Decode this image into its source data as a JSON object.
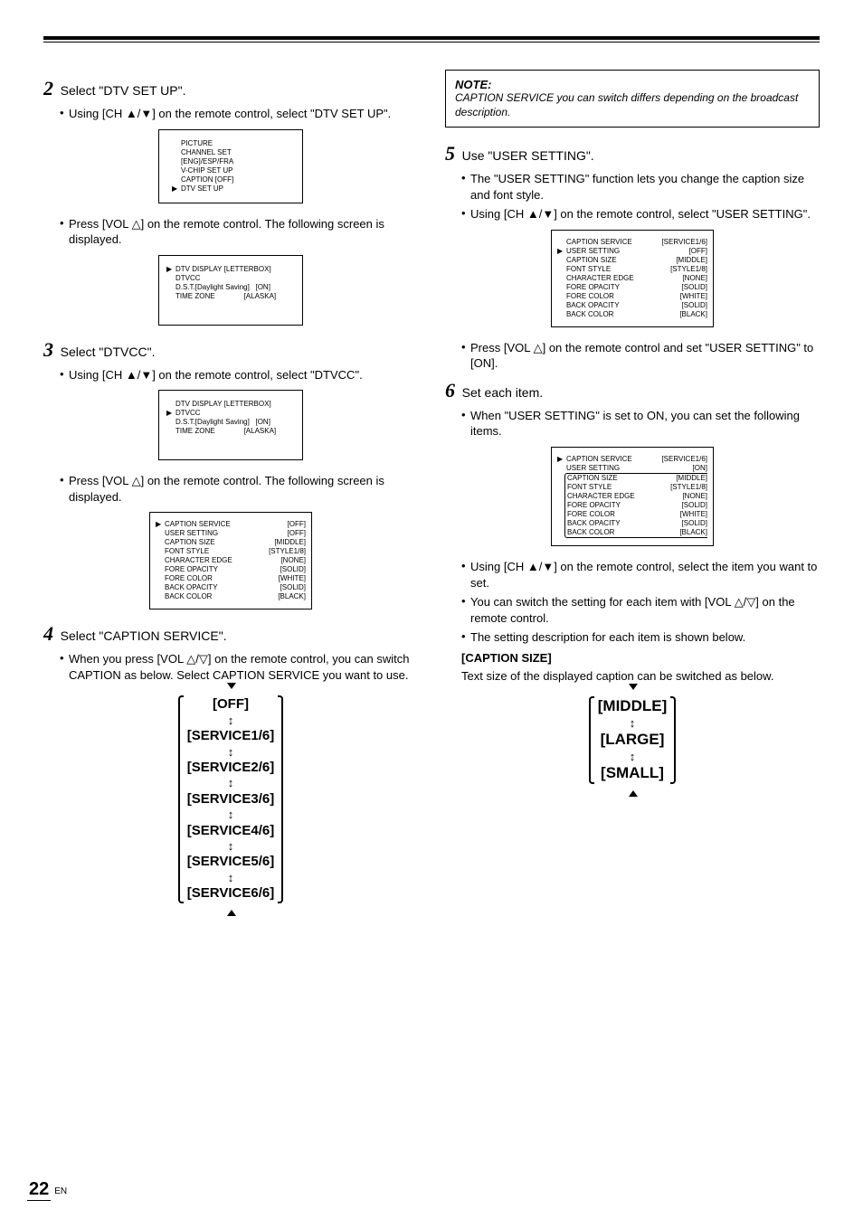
{
  "pageNumber": "22",
  "pageLang": "EN",
  "left": {
    "step2": {
      "num": "2",
      "title": "Select \"DTV SET UP\".",
      "b1": "Using [CH ▲/▼] on the remote control, select \"DTV SET UP\".",
      "menu1": {
        "r1": "PICTURE",
        "r2": "CHANNEL SET",
        "r3": "[ENG]/ESP/FRA",
        "r4": "V-CHIP SET UP",
        "r5": "CAPTION [OFF]",
        "r6": "DTV SET UP"
      },
      "b2": "Press [VOL △] on the remote control. The following screen is displayed.",
      "menu2": {
        "r1l": "DTV DISPLAY",
        "r1v": "[LETTERBOX]",
        "r2l": "DTVCC",
        "r3l": "D.S.T.[Daylight Saving]",
        "r3v": "[ON]",
        "r4l": "TIME ZONE",
        "r4v": "[ALASKA]"
      }
    },
    "step3": {
      "num": "3",
      "title": "Select \"DTVCC\".",
      "b1": "Using [CH ▲/▼] on the remote control, select \"DTVCC\".",
      "menu1": {
        "r1l": "DTV DISPLAY",
        "r1v": "[LETTERBOX]",
        "r2l": "DTVCC",
        "r3l": "D.S.T.[Daylight Saving]",
        "r3v": "[ON]",
        "r4l": "TIME ZONE",
        "r4v": "[ALASKA]"
      },
      "b2": "Press [VOL △] on the remote control. The following screen is displayed.",
      "menu2": {
        "r1l": "CAPTION SERVICE",
        "r1v": "[OFF]",
        "r2l": "USER SETTING",
        "r2v": "[OFF]",
        "r3l": "CAPTION SIZE",
        "r3v": "[MIDDLE]",
        "r4l": "FONT STYLE",
        "r4v": "[STYLE1/8]",
        "r5l": "CHARACTER EDGE",
        "r5v": "[NONE]",
        "r6l": "FORE OPACITY",
        "r6v": "[SOLID]",
        "r7l": "FORE COLOR",
        "r7v": "[WHITE]",
        "r8l": "BACK OPACITY",
        "r8v": "[SOLID]",
        "r9l": "BACK COLOR",
        "r9v": "[BLACK]"
      }
    },
    "step4": {
      "num": "4",
      "title": "Select \"CAPTION SERVICE\".",
      "b1": "When you press [VOL △/▽] on the remote control, you can switch CAPTION as below. Select CAPTION SERVICE you want to use.",
      "cycle": {
        "i1": "[OFF]",
        "i2": "[SERVICE1/6]",
        "i3": "[SERVICE2/6]",
        "i4": "[SERVICE3/6]",
        "i5": "[SERVICE4/6]",
        "i6": "[SERVICE5/6]",
        "i7": "[SERVICE6/6]"
      }
    }
  },
  "right": {
    "note": {
      "title": "NOTE:",
      "text": "CAPTION SERVICE you can switch differs depending on the broadcast description."
    },
    "step5": {
      "num": "5",
      "title": "Use \"USER SETTING\".",
      "b1": "The \"USER SETTING\" function lets you change the caption size and font style.",
      "b2": "Using [CH ▲/▼] on the remote control, select \"USER SETTING\".",
      "menu": {
        "r1l": "CAPTION SERVICE",
        "r1v": "[SERVICE1/6]",
        "r2l": "USER SETTING",
        "r2v": "[OFF]",
        "r3l": "CAPTION SIZE",
        "r3v": "[MIDDLE]",
        "r4l": "FONT STYLE",
        "r4v": "[STYLE1/8]",
        "r5l": "CHARACTER EDGE",
        "r5v": "[NONE]",
        "r6l": "FORE OPACITY",
        "r6v": "[SOLID]",
        "r7l": "FORE COLOR",
        "r7v": "[WHITE]",
        "r8l": "BACK OPACITY",
        "r8v": "[SOLID]",
        "r9l": "BACK COLOR",
        "r9v": "[BLACK]"
      },
      "b3": "Press [VOL △] on the remote control and set \"USER SETTING\" to [ON]."
    },
    "step6": {
      "num": "6",
      "title": "Set each item.",
      "b1": "When \"USER SETTING\" is set to ON, you can set the following items.",
      "menu": {
        "r1l": "CAPTION SERVICE",
        "r1v": "[SERVICE1/6]",
        "r2l": "USER SETTING",
        "r2v": "[ON]",
        "r3l": "CAPTION SIZE",
        "r3v": "[MIDDLE]",
        "r4l": "FONT STYLE",
        "r4v": "[STYLE1/8]",
        "r5l": "CHARACTER EDGE",
        "r5v": "[NONE]",
        "r6l": "FORE OPACITY",
        "r6v": "[SOLID]",
        "r7l": "FORE COLOR",
        "r7v": "[WHITE]",
        "r8l": "BACK OPACITY",
        "r8v": "[SOLID]",
        "r9l": "BACK COLOR",
        "r9v": "[BLACK]"
      },
      "b2": "Using [CH ▲/▼] on the remote control, select the item you want to set.",
      "b3": "You can switch the setting for each item with [VOL △/▽] on the remote control.",
      "b4": "The setting description for each item is shown below.",
      "capSizeHead": "[CAPTION SIZE]",
      "capSizeText": "Text size of the displayed caption can be switched as below.",
      "cycle": {
        "i1": "[MIDDLE]",
        "i2": "[LARGE]",
        "i3": "[SMALL]"
      }
    }
  }
}
